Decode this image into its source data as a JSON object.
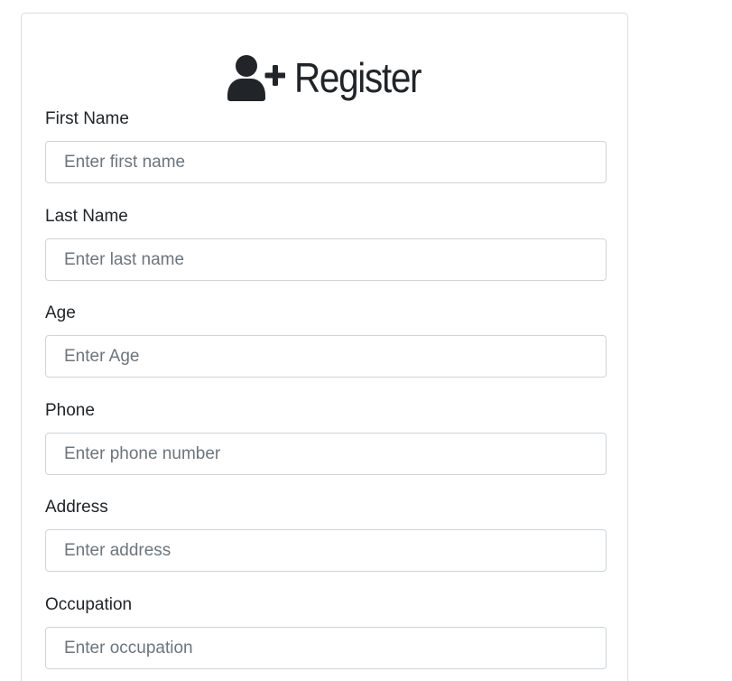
{
  "form": {
    "title": "Register",
    "title_icon": "user-plus-icon",
    "fields": [
      {
        "label": "First Name",
        "placeholder": "Enter first name",
        "value": ""
      },
      {
        "label": "Last Name",
        "placeholder": "Enter last name",
        "value": ""
      },
      {
        "label": "Age",
        "placeholder": "Enter Age",
        "value": ""
      },
      {
        "label": "Phone",
        "placeholder": "Enter phone number",
        "value": ""
      },
      {
        "label": "Address",
        "placeholder": "Enter address",
        "value": ""
      },
      {
        "label": "Occupation",
        "placeholder": "Enter occupation",
        "value": ""
      }
    ]
  },
  "colors": {
    "text": "#212529",
    "placeholder": "#6c757d",
    "input_border": "#ced4da",
    "card_border": "#dcdcdc"
  }
}
